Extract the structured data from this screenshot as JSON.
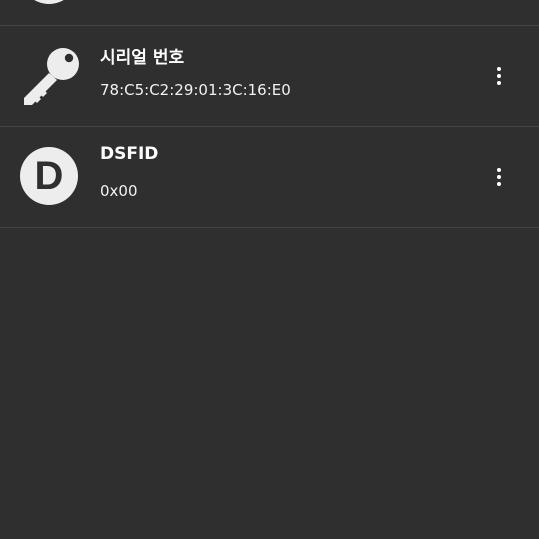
{
  "theme": {
    "background": "#2f2f2f",
    "divider": "#454545",
    "icon_fill": "#ededed"
  },
  "items": [
    {
      "title": "시리얼 번호",
      "value": "78:C5:C2:29:01:3C:16:E0",
      "icon": "key-icon"
    },
    {
      "title": "DSFID",
      "value": "0x00",
      "icon": "letter-d-avatar",
      "avatar_letter": "D"
    }
  ]
}
